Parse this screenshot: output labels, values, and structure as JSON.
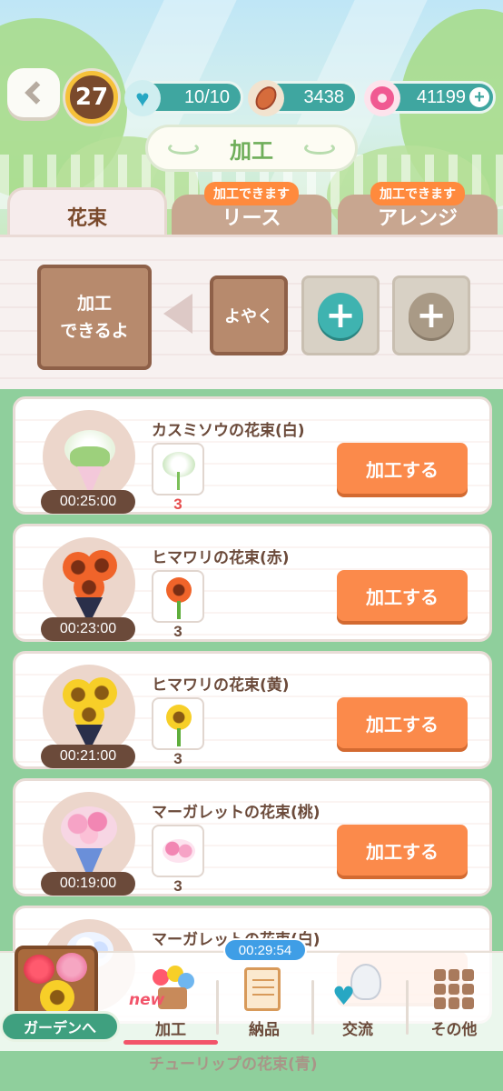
{
  "status": {
    "level": "27",
    "hearts": "10/10",
    "shells": "3438",
    "donuts": "41199"
  },
  "header": {
    "title": "加工"
  },
  "tabs": [
    {
      "label": "花束",
      "badge": ""
    },
    {
      "label": "リース",
      "badge": "加工できます"
    },
    {
      "label": "アレンジ",
      "badge": "加工できます"
    }
  ],
  "queue": {
    "main_line1": "加工",
    "main_line2": "できるよ",
    "reserve": "よやく"
  },
  "recipes": [
    {
      "name": "カスミソウの花束(白)",
      "time": "00:25:00",
      "qty": "3",
      "button": "加工する"
    },
    {
      "name": "ヒマワリの花束(赤)",
      "time": "00:23:00",
      "qty": "3",
      "button": "加工する"
    },
    {
      "name": "ヒマワリの花束(黄)",
      "time": "00:21:00",
      "qty": "3",
      "button": "加工する"
    },
    {
      "name": "マーガレットの花束(桃)",
      "time": "00:19:00",
      "qty": "3",
      "button": "加工する"
    },
    {
      "name": "マーガレットの花束(白)",
      "time": "",
      "qty": "",
      "button": ""
    }
  ],
  "peek_item": "チューリップの花束(青)",
  "nav": {
    "garden": "ガーデンへ",
    "new_tag": "new",
    "timer": "00:29:54",
    "craft": "加工",
    "deliver": "納品",
    "exchange": "交流",
    "other": "その他"
  },
  "colors": {
    "accent_orange": "#fb8a4b",
    "teal": "#3fa6a0",
    "brown": "#6b4a3a",
    "green_bg": "#8fcf9c",
    "warn_red": "#e64d4d"
  },
  "icons": [
    "back-chevron-icon",
    "heart-icon",
    "shell-icon",
    "donut-icon",
    "plus-icon",
    "bouquet-icon",
    "notepad-icon",
    "ghost-heart-icon",
    "grid-icon"
  ]
}
